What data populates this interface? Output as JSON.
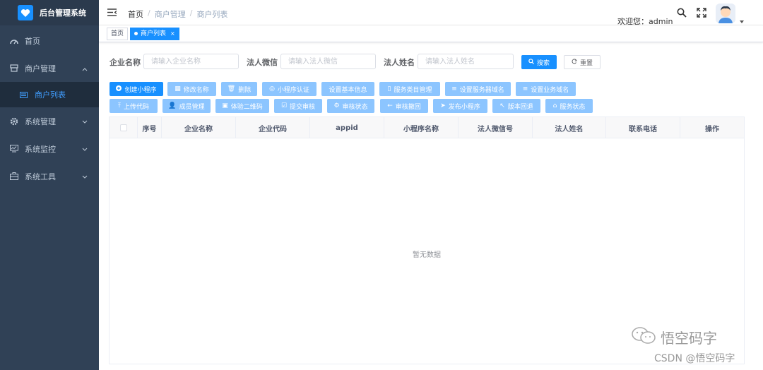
{
  "app": {
    "title": "后台管理系统"
  },
  "sidebar": {
    "items": [
      {
        "label": "首页",
        "icon": "dashboard-icon"
      },
      {
        "label": "商户管理",
        "icon": "shop-icon",
        "expanded": true,
        "children": [
          {
            "label": "商户列表",
            "icon": "list-icon",
            "active": true
          }
        ]
      },
      {
        "label": "系统管理",
        "icon": "gear-icon"
      },
      {
        "label": "系统监控",
        "icon": "monitor-icon"
      },
      {
        "label": "系统工具",
        "icon": "toolbox-icon"
      }
    ]
  },
  "header": {
    "breadcrumb": [
      "首页",
      "商户管理",
      "商户列表"
    ],
    "welcome": "欢迎您：admin"
  },
  "tags": [
    {
      "label": "首页",
      "active": false
    },
    {
      "label": "商户列表",
      "active": true,
      "close": "×"
    }
  ],
  "search": {
    "fields": [
      {
        "label": "企业名称",
        "placeholder": "请输入企业名称"
      },
      {
        "label": "法人微信",
        "placeholder": "请输入法人微信"
      },
      {
        "label": "法人姓名",
        "placeholder": "请输入法人姓名"
      }
    ],
    "search_label": "搜索",
    "reset_label": "重置"
  },
  "toolbar": {
    "row1": [
      "创建小程序",
      "修改名称",
      "删除",
      "小程序认证",
      "设置基本信息",
      "服务类目管理",
      "设置服务器域名",
      "设置业务域名"
    ],
    "row2": [
      "上传代码",
      "成员管理",
      "体验二维码",
      "提交审核",
      "审核状态",
      "审核撤回",
      "发布小程序",
      "版本回退",
      "服务状态"
    ]
  },
  "table": {
    "columns": [
      "序号",
      "企业名称",
      "企业代码",
      "appid",
      "小程序名称",
      "法人微信号",
      "法人姓名",
      "联系电话",
      "操作"
    ],
    "empty_text": "暂无数据"
  },
  "watermark": {
    "line1": "悟空码字",
    "line2": "CSDN @悟空码字"
  },
  "colors": {
    "sidebar_bg": "#304156",
    "primary": "#1890ff",
    "primary_light": "#8cc5ff"
  }
}
